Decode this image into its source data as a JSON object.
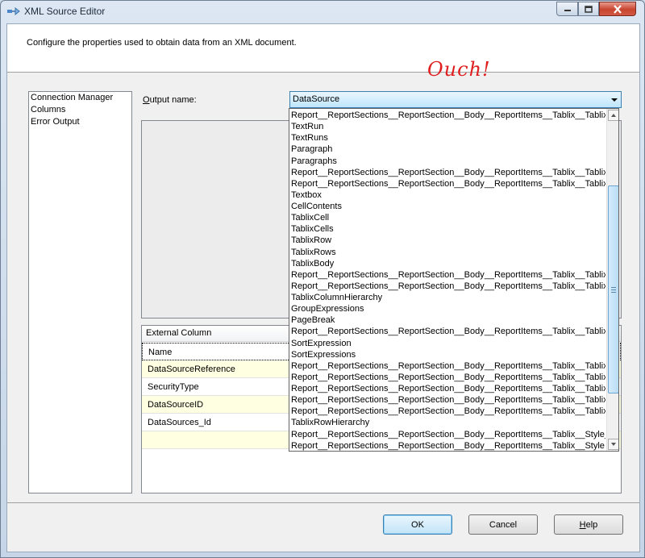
{
  "window": {
    "title": "XML Source Editor"
  },
  "header": {
    "description": "Configure the properties used to obtain data from an XML document.",
    "annotation": "Ouch!"
  },
  "nav": {
    "items": [
      "Connection Manager",
      "Columns",
      "Error Output"
    ]
  },
  "output": {
    "label_prefix": "O",
    "label_rest": "utput name:",
    "selected": "DataSource"
  },
  "dropdown_items": [
    "Report__ReportSections__ReportSection__Body__ReportItems__Tablix__TablixBo",
    "TextRun",
    "TextRuns",
    "Paragraph",
    "Paragraphs",
    "Report__ReportSections__ReportSection__Body__ReportItems__Tablix__TablixBo",
    "Report__ReportSections__ReportSection__Body__ReportItems__Tablix__TablixBo",
    "Textbox",
    "CellContents",
    "TablixCell",
    "TablixCells",
    "TablixRow",
    "TablixRows",
    "TablixBody",
    "Report__ReportSections__ReportSection__Body__ReportItems__Tablix__TablixCo",
    "Report__ReportSections__ReportSection__Body__ReportItems__Tablix__TablixCo",
    "TablixColumnHierarchy",
    "GroupExpressions",
    "PageBreak",
    "Report__ReportSections__ReportSection__Body__ReportItems__Tablix__TablixRo",
    "SortExpression",
    "SortExpressions",
    "Report__ReportSections__ReportSection__Body__ReportItems__Tablix__TablixRo",
    "Report__ReportSections__ReportSection__Body__ReportItems__Tablix__TablixRo",
    "Report__ReportSections__ReportSection__Body__ReportItems__Tablix__TablixRo",
    "Report__ReportSections__ReportSection__Body__ReportItems__Tablix__TablixRo",
    "Report__ReportSections__ReportSection__Body__ReportItems__Tablix__TablixRo",
    "TablixRowHierarchy",
    "Report__ReportSections__ReportSection__Body__ReportItems__Tablix__Style__Bo",
    "Report__ReportSections__ReportSection__Body__ReportItems__Tablix__Style"
  ],
  "grid": {
    "header": "External Column",
    "rows": [
      "Name",
      "DataSourceReference",
      "SecurityType",
      "DataSourceID",
      "DataSources_Id",
      ""
    ]
  },
  "buttons": {
    "ok": "OK",
    "cancel": "Cancel",
    "help_prefix": "H",
    "help_rest": "elp"
  }
}
